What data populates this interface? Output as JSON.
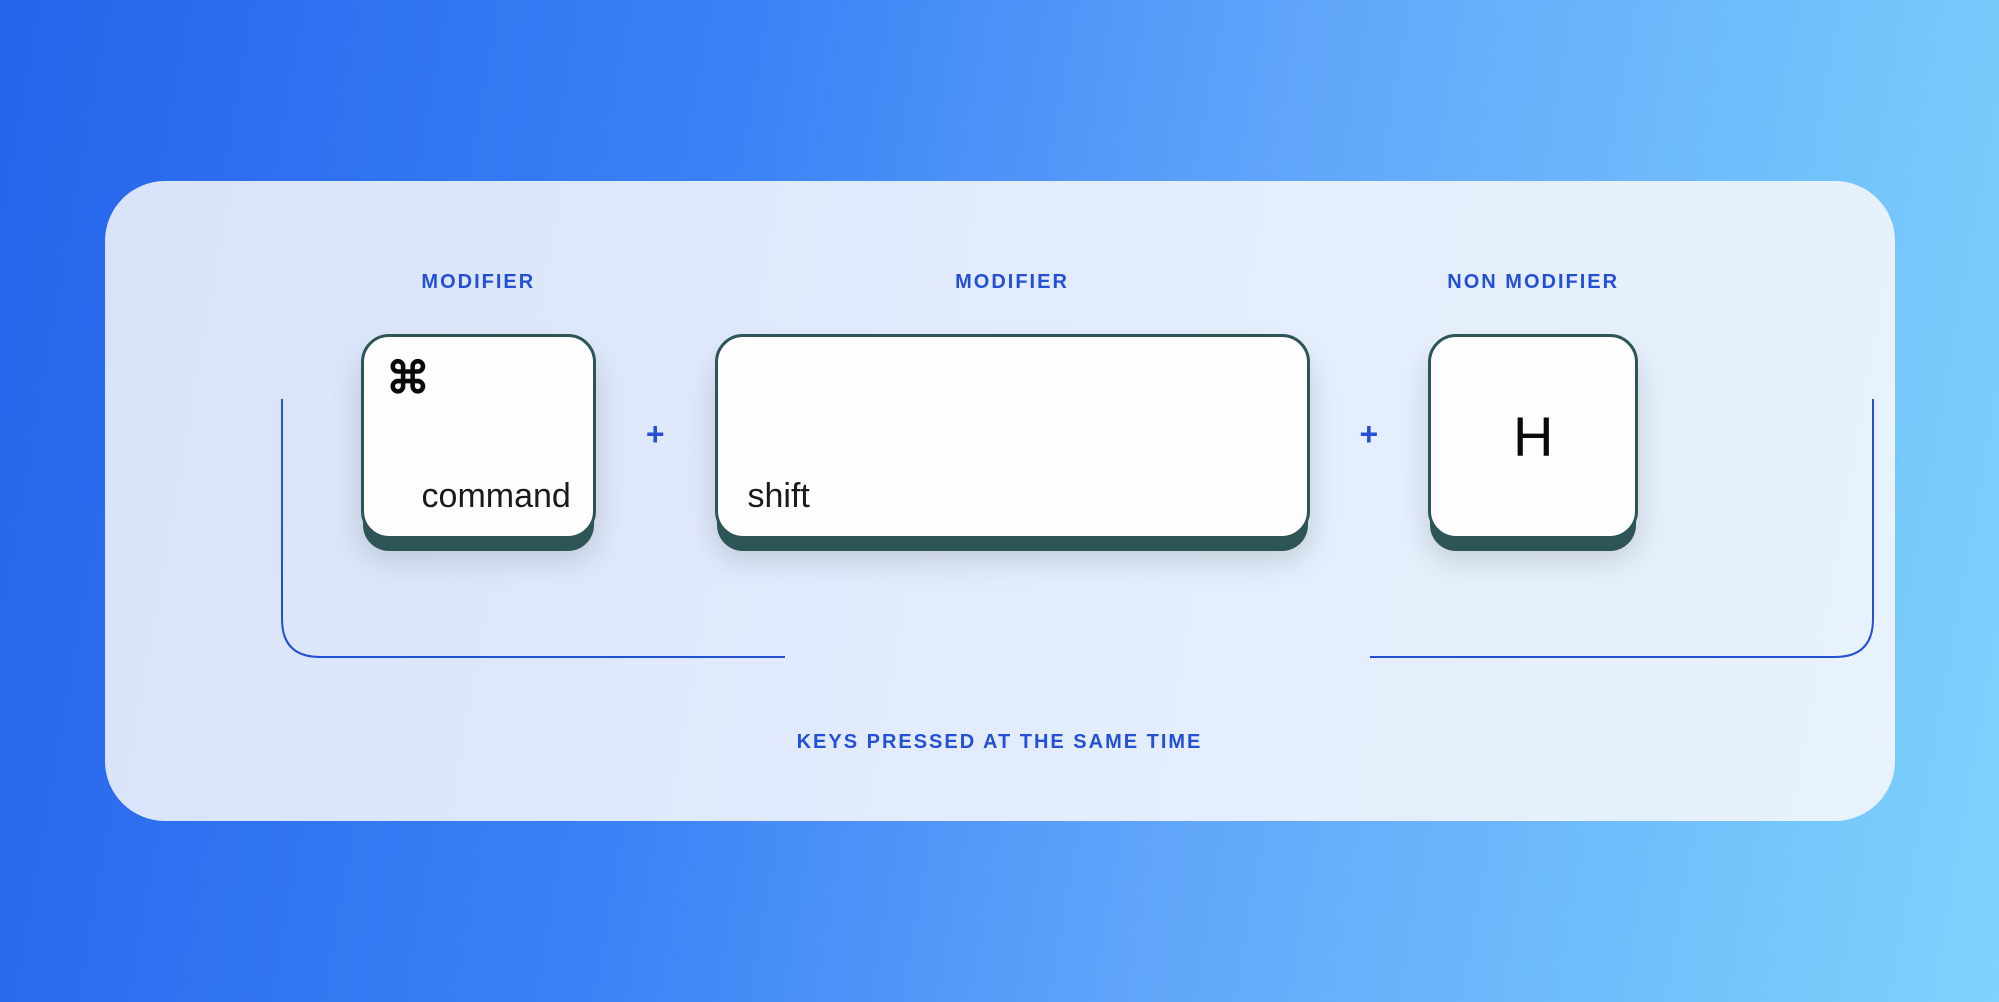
{
  "labels": {
    "key1_label": "MODIFIER",
    "key2_label": "MODIFIER",
    "key3_label": "NON MODIFIER"
  },
  "keys": {
    "command_symbol": "⌘",
    "command_text": "command",
    "shift_text": "shift",
    "h_text": "H"
  },
  "separators": {
    "plus1": "+",
    "plus2": "+"
  },
  "caption": "KEYS PRESSED AT THE SAME TIME",
  "colors": {
    "accent": "#2450d6",
    "key_border": "#2d5556"
  }
}
